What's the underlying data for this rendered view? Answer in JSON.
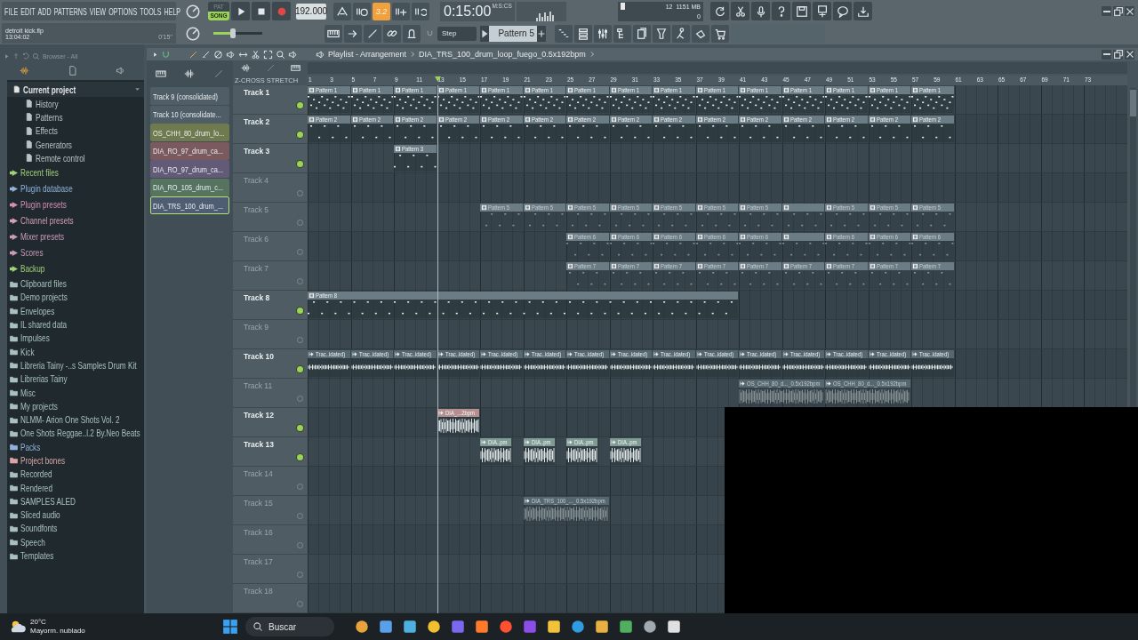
{
  "menu": [
    "FILE",
    "EDIT",
    "ADD",
    "PATTERNS",
    "VIEW",
    "OPTIONS",
    "TOOLS",
    "HELP"
  ],
  "transport": {
    "modes": [
      {
        "label": "PAT",
        "selected": false
      },
      {
        "label": "SONG",
        "selected": true
      }
    ],
    "tempo": "192.000",
    "time": "0:15:00",
    "time_unit": "M:S:CS"
  },
  "typing_keyboard": {
    "label": "3.2",
    "on": true
  },
  "file": {
    "name": "detroit kick.flp",
    "clock": "13:04:02",
    "duration": "0'15''"
  },
  "master_volume": {
    "level": 0.4
  },
  "monitor": {
    "counter": "12",
    "memory": "1151 MB",
    "counter_2": "0"
  },
  "snap": "Step",
  "pattern": "Pattern 5",
  "browser": {
    "title": "Browser - All",
    "items": [
      {
        "label": "Current project",
        "kind": "project",
        "color": "#e4e4e4",
        "expanded": true,
        "children": [
          {
            "label": "History",
            "kind": "page",
            "color": "#b9c3c8"
          },
          {
            "label": "Patterns",
            "kind": "page",
            "color": "#b9c3c8"
          },
          {
            "label": "Effects",
            "kind": "page",
            "color": "#b9c3c8"
          },
          {
            "label": "Generators",
            "kind": "page",
            "color": "#b9c3c8"
          },
          {
            "label": "Remote control",
            "kind": "page",
            "color": "#b9c3c8"
          }
        ]
      },
      {
        "label": "Recent files",
        "kind": "category",
        "color": "#9fd07a"
      },
      {
        "label": "Plugin database",
        "kind": "category",
        "color": "#8fb3dd"
      },
      {
        "label": "Plugin presets",
        "kind": "category",
        "color": "#d58fb3"
      },
      {
        "label": "Channel presets",
        "kind": "category",
        "color": "#d3a0b8"
      },
      {
        "label": "Mixer presets",
        "kind": "category",
        "color": "#c99bb5"
      },
      {
        "label": "Scores",
        "kind": "category",
        "color": "#c99bb5"
      },
      {
        "label": "Backup",
        "kind": "category",
        "color": "#9fd07a"
      },
      {
        "label": "Clipboard files",
        "kind": "folder",
        "color": "#a9c0c0"
      },
      {
        "label": "Demo projects",
        "kind": "folder",
        "color": "#a9c0c0"
      },
      {
        "label": "Envelopes",
        "kind": "folder",
        "color": "#a9c0c0"
      },
      {
        "label": "IL shared data",
        "kind": "folder",
        "color": "#a9c0c0"
      },
      {
        "label": "Impulses",
        "kind": "folder",
        "color": "#a9c0c0"
      },
      {
        "label": "Kick",
        "kind": "folder",
        "color": "#a9c0c0"
      },
      {
        "label": "Libreria Tainy -..s Samples Drum Kit",
        "kind": "folder",
        "color": "#a9c0c0"
      },
      {
        "label": "Librerias Tainy",
        "kind": "folder",
        "color": "#a9c0c0"
      },
      {
        "label": "Misc",
        "kind": "folder",
        "color": "#a9c0c0"
      },
      {
        "label": "My projects",
        "kind": "folder",
        "color": "#a9c0c0"
      },
      {
        "label": "NLMM- Arion One Shots Vol. 2",
        "kind": "folder",
        "color": "#a9c0c0"
      },
      {
        "label": "One Shots Reggae..l.2 By.Neo Beats",
        "kind": "folder",
        "color": "#a9c0c0"
      },
      {
        "label": "Packs",
        "kind": "folder",
        "color": "#8fb3dd"
      },
      {
        "label": "Project bones",
        "kind": "folder",
        "color": "#d9a6a6"
      },
      {
        "label": "Recorded",
        "kind": "folder",
        "color": "#a9c0c0"
      },
      {
        "label": "Rendered",
        "kind": "folder",
        "color": "#a9c0c0"
      },
      {
        "label": "SAMPLES ALED",
        "kind": "folder",
        "color": "#a9c0c0"
      },
      {
        "label": "Sliced audio",
        "kind": "folder",
        "color": "#a9c0c0"
      },
      {
        "label": "Soundfonts",
        "kind": "folder",
        "color": "#a9c0c0"
      },
      {
        "label": "Speech",
        "kind": "folder",
        "color": "#a9c0c0"
      },
      {
        "label": "Templates",
        "kind": "folder",
        "color": "#a9c0c0"
      }
    ]
  },
  "clip_list": [
    {
      "label": "Track 9 (consolidated)",
      "color": "#4f5d66",
      "selected": false
    },
    {
      "label": "Track 10 (consolidate...",
      "color": "#4f5d66",
      "selected": false
    },
    {
      "label": "OS_CHH_80_drum_lo...",
      "color": "#6f7a4e",
      "selected": false
    },
    {
      "label": "DIA_RO_97_drum_ca...",
      "color": "#7a5a5e",
      "selected": false
    },
    {
      "label": "DIA_RO_97_drum_ca...",
      "color": "#635a78",
      "selected": false
    },
    {
      "label": "DIA_RO_105_drum_c...",
      "color": "#55735e",
      "selected": false
    },
    {
      "label": "DIA_TRS_100_drum_...",
      "color": "#4f5d73",
      "selected": true
    }
  ],
  "playlist": {
    "title": "Playlist - Arrangement",
    "breadcrumb": "DIA_TRS_100_drum_loop_fuego_0.5x192bpm",
    "crossfade_label": "Z-CROSS",
    "stretch_label": "STRETCH",
    "playhead": {
      "level": 0.1579
    },
    "ruler": [
      "1",
      "3",
      "5",
      "7",
      "9",
      "11",
      "13",
      "15",
      "17",
      "19",
      "21",
      "23",
      "25",
      "27",
      "29",
      "31",
      "33",
      "35",
      "37",
      "39",
      "41",
      "43",
      "45",
      "47",
      "49",
      "51",
      "53",
      "55",
      "57",
      "59",
      "61",
      "63",
      "65",
      "67",
      "69",
      "71",
      "73"
    ],
    "tracks": [
      {
        "name": "Track 1",
        "muted": false,
        "clips": [
          {
            "label": "Pattern 1",
            "kind": "pattern",
            "color": "#6b7c85"
          },
          {
            "label": "Pattern 1",
            "kind": "pattern",
            "color": "#6b7c85"
          },
          {
            "label": "Pattern 1",
            "kind": "pattern",
            "color": "#6b7c85"
          },
          {
            "label": "Pattern 1",
            "kind": "pattern",
            "color": "#6b7c85"
          },
          {
            "label": "Pattern 1",
            "kind": "pattern",
            "color": "#6b7c85"
          },
          {
            "label": "Pattern 1",
            "kind": "pattern",
            "color": "#6b7c85"
          },
          {
            "label": "Pattern 1",
            "kind": "pattern",
            "color": "#6b7c85"
          },
          {
            "label": "Pattern 1",
            "kind": "pattern",
            "color": "#6b7c85"
          },
          {
            "label": "Pattern 1",
            "kind": "pattern",
            "color": "#6b7c85"
          },
          {
            "label": "Pattern 1",
            "kind": "pattern",
            "color": "#6b7c85"
          },
          {
            "label": "Pattern 1",
            "kind": "pattern",
            "color": "#6b7c85"
          },
          {
            "label": "Pattern 1",
            "kind": "pattern",
            "color": "#6b7c85"
          },
          {
            "label": "Pattern 1",
            "kind": "pattern",
            "color": "#6b7c85"
          },
          {
            "label": "Pattern 1",
            "kind": "pattern",
            "color": "#6b7c85"
          },
          {
            "label": "Pattern 1",
            "kind": "pattern",
            "color": "#6b7c85"
          }
        ]
      },
      {
        "name": "Track 2",
        "muted": false,
        "clips": [
          {
            "label": "Pattern 2",
            "kind": "pattern",
            "color": "#6b7c85"
          },
          {
            "label": "Pattern 2",
            "kind": "pattern",
            "color": "#6b7c85"
          },
          {
            "label": "Pattern 2",
            "kind": "pattern",
            "color": "#6b7c85"
          },
          {
            "label": "Pattern 2",
            "kind": "pattern",
            "color": "#6b7c85"
          },
          {
            "label": "Pattern 2",
            "kind": "pattern",
            "color": "#6b7c85"
          },
          {
            "label": "Pattern 2",
            "kind": "pattern",
            "color": "#6b7c85"
          },
          {
            "label": "Pattern 2",
            "kind": "pattern",
            "color": "#6b7c85"
          },
          {
            "label": "Pattern 2",
            "kind": "pattern",
            "color": "#6b7c85"
          },
          {
            "label": "Pattern 2",
            "kind": "pattern",
            "color": "#6b7c85"
          },
          {
            "label": "Pattern 2",
            "kind": "pattern",
            "color": "#6b7c85"
          },
          {
            "label": "Pattern 2",
            "kind": "pattern",
            "color": "#6b7c85"
          },
          {
            "label": "Pattern 2",
            "kind": "pattern",
            "color": "#6b7c85"
          },
          {
            "label": "Pattern 2",
            "kind": "pattern",
            "color": "#6b7c85"
          },
          {
            "label": "Pattern 2",
            "kind": "pattern",
            "color": "#6b7c85"
          },
          {
            "label": "Pattern 2",
            "kind": "pattern",
            "color": "#6b7c85"
          }
        ]
      },
      {
        "name": "Track 3",
        "muted": false,
        "clips": [
          {
            "label": "Pattern 3",
            "kind": "pattern",
            "color": "#6b7c85"
          }
        ]
      },
      {
        "name": "Track 4",
        "muted": true
      },
      {
        "name": "Track 5",
        "muted": true,
        "clips": [
          {
            "label": "Pattern 5",
            "kind": "pattern",
            "color": "#6b7c85"
          },
          {
            "label": "Pattern 5",
            "kind": "pattern",
            "color": "#6b7c85"
          },
          {
            "label": "Pattern 5",
            "kind": "pattern",
            "color": "#6b7c85"
          },
          {
            "label": "Pattern 5",
            "kind": "pattern",
            "color": "#6b7c85"
          },
          {
            "label": "Pattern 5",
            "kind": "pattern",
            "color": "#6b7c85"
          },
          {
            "label": "Pattern 5",
            "kind": "pattern",
            "color": "#6b7c85"
          },
          {
            "label": "Pattern 5",
            "kind": "pattern",
            "color": "#6b7c85"
          },
          {
            "kind": "pattern",
            "color": "#6b7c85"
          },
          {
            "label": "Pattern 5",
            "kind": "pattern",
            "color": "#6b7c85"
          },
          {
            "label": "Pattern 5",
            "kind": "pattern",
            "color": "#6b7c85"
          },
          {
            "label": "Pattern 5",
            "kind": "pattern",
            "color": "#6b7c85"
          }
        ]
      },
      {
        "name": "Track 6",
        "muted": true,
        "clips": [
          {
            "label": "Pattern 6",
            "kind": "pattern",
            "color": "#6b7c85"
          },
          {
            "label": "Pattern 6",
            "kind": "pattern",
            "color": "#6b7c85"
          },
          {
            "label": "Pattern 6",
            "kind": "pattern",
            "color": "#6b7c85"
          },
          {
            "label": "Pattern 6",
            "kind": "pattern",
            "color": "#6b7c85"
          },
          {
            "label": "Pattern 6",
            "kind": "pattern",
            "color": "#6b7c85"
          },
          {
            "kind": "pattern",
            "color": "#6b7c85"
          },
          {
            "label": "Pattern 6",
            "kind": "pattern",
            "color": "#6b7c85"
          },
          {
            "label": "Pattern 6",
            "kind": "pattern",
            "color": "#6b7c85"
          },
          {
            "label": "Pattern 6",
            "kind": "pattern",
            "color": "#6b7c85"
          }
        ]
      },
      {
        "name": "Track 7",
        "muted": true,
        "clips": [
          {
            "label": "Pattern 7",
            "kind": "pattern",
            "color": "#6b7c85"
          },
          {
            "label": "Pattern 7",
            "kind": "pattern",
            "color": "#6b7c85"
          },
          {
            "label": "Pattern 7",
            "kind": "pattern",
            "color": "#6b7c85"
          },
          {
            "label": "Pattern 7",
            "kind": "pattern",
            "color": "#6b7c85"
          },
          {
            "label": "Pattern 7",
            "kind": "pattern",
            "color": "#6b7c85"
          },
          {
            "label": "Pattern 7",
            "kind": "pattern",
            "color": "#6b7c85"
          },
          {
            "label": "Pattern 7",
            "kind": "pattern",
            "color": "#6b7c85"
          },
          {
            "label": "Pattern 7",
            "kind": "pattern",
            "color": "#6b7c85"
          },
          {
            "label": "Pattern 7",
            "kind": "pattern",
            "color": "#6b7c85"
          }
        ]
      },
      {
        "name": "Track 8",
        "muted": false,
        "clips": [
          {
            "label": "Pattern 8",
            "kind": "pattern",
            "color": "#6b7c85"
          }
        ]
      },
      {
        "name": "Track 9",
        "muted": true
      },
      {
        "name": "Track 10",
        "muted": false,
        "clips": [
          {
            "label": "Trac..idated)",
            "kind": "audio",
            "color": "#56676f"
          },
          {
            "label": "Trac..idated)",
            "kind": "audio",
            "color": "#56676f"
          },
          {
            "label": "Trac..idated)",
            "kind": "audio",
            "color": "#56676f"
          },
          {
            "label": "Trac..idated)",
            "kind": "audio",
            "color": "#56676f"
          },
          {
            "label": "Trac..idated)",
            "kind": "audio",
            "color": "#56676f"
          },
          {
            "label": "Trac..idated)",
            "kind": "audio",
            "color": "#56676f"
          },
          {
            "label": "Trac..idated)",
            "kind": "audio",
            "color": "#56676f"
          },
          {
            "label": "Trac..idated)",
            "kind": "audio",
            "color": "#56676f"
          },
          {
            "label": "Trac..idated)",
            "kind": "audio",
            "color": "#56676f"
          },
          {
            "label": "Trac..idated)",
            "kind": "audio",
            "color": "#56676f"
          },
          {
            "label": "Trac..idated)",
            "kind": "audio",
            "color": "#56676f"
          },
          {
            "label": "Trac..idated)",
            "kind": "audio",
            "color": "#56676f"
          },
          {
            "label": "Trac..idated)",
            "kind": "audio",
            "color": "#56676f"
          },
          {
            "label": "Trac..idated)",
            "kind": "audio",
            "color": "#56676f"
          },
          {
            "label": "Trac..idated)",
            "kind": "audio",
            "color": "#56676f"
          }
        ]
      },
      {
        "name": "Track 11",
        "muted": true,
        "clips": [
          {
            "label": "OS_CHH_80_d..._0.5x192bpm",
            "kind": "audio",
            "color": "#56676f"
          },
          {
            "label": "OS_CHH_80_d..._0.5x192bpm",
            "kind": "audio",
            "color": "#56676f"
          }
        ]
      },
      {
        "name": "Track 12",
        "muted": false,
        "clips": [
          {
            "label": "DIA_...2bpm",
            "kind": "audio",
            "color": "#b58f8f"
          }
        ]
      },
      {
        "name": "Track 13",
        "muted": false,
        "clips": [
          {
            "label": "DIA..pm",
            "kind": "audio",
            "color": "#7f9b93"
          },
          {
            "label": "DIA..pm",
            "kind": "audio",
            "color": "#7f9b93"
          },
          {
            "label": "DIA..pm",
            "kind": "audio",
            "color": "#7f9b93"
          },
          {
            "label": "DIA..pm",
            "kind": "audio",
            "color": "#7f9b93"
          }
        ]
      },
      {
        "name": "Track 14",
        "muted": true
      },
      {
        "name": "Track 15",
        "muted": true,
        "clips": [
          {
            "label": "DIA_TRS_100_..._0.5x192bpm",
            "kind": "audio",
            "color": "#56676f"
          }
        ]
      },
      {
        "name": "Track 16",
        "muted": true
      },
      {
        "name": "Track 17",
        "muted": true
      },
      {
        "name": "Track 18",
        "muted": true
      }
    ]
  },
  "taskbar": {
    "temperature": "20°C",
    "weather": "Mayorm. nublado",
    "search": {
      "placeholder": "Buscar"
    }
  }
}
